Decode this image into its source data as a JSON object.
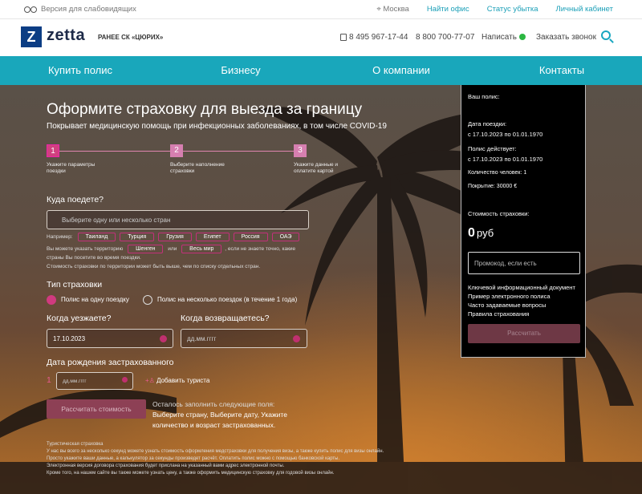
{
  "topbar": {
    "accessibility": "Версия для слабовидящих",
    "city": "Москва",
    "links": [
      "Найти офис",
      "Статус убытка",
      "Личный кабинет"
    ]
  },
  "header": {
    "logo_letter": "Z",
    "logo_text": "zetta",
    "former_name": "РАНЕЕ СК «ЦЮРИХ»",
    "phone1": "8 495 967-17-44",
    "phone2": "8 800 700-77-07",
    "write": "Написать",
    "callback": "Заказать звонок"
  },
  "nav": [
    "Купить полис",
    "Бизнесу",
    "О компании",
    "Контакты"
  ],
  "form": {
    "title": "Оформите страховку для выезда за границу",
    "subtitle": "Покрывает медицинскую помощь при инфекционных заболеваниях, в том числе COVID-19",
    "steps": [
      {
        "num": "1",
        "label": "Укажите параметры поездки"
      },
      {
        "num": "2",
        "label": "Выберите наполнение страховки"
      },
      {
        "num": "3",
        "label": "Укажите данные и оплатите картой"
      }
    ],
    "where_label": "Куда поедете?",
    "where_placeholder": "Выберите одну или несколько стран",
    "example_label": "Например:",
    "countries": [
      "Таиланд",
      "Турция",
      "Грузия",
      "Египет",
      "Россия",
      "ОАЭ"
    ],
    "territory_text_1": "Вы можете указать территорию",
    "territory_schengen": "Шенген",
    "territory_or": "или",
    "territory_world": "Весь мир",
    "territory_text_2": ", если не знаете точно, какие",
    "territory_text_3": "страны Вы посетите во время поездки.",
    "territory_text_4": "Стоимость страховки по территории может быть выше, чем по списку отдельных стран.",
    "type_label": "Тип страховки",
    "type_options": [
      "Полис на одну поездку",
      "Полис на несколько поездок (в течение 1 года)"
    ],
    "depart_label": "Когда уезжаете?",
    "depart_value": "17.10.2023",
    "return_label": "Когда возвращаетесь?",
    "return_placeholder": "дд.мм.гггг",
    "birth_label": "Дата рождения застрахованного",
    "birth_index": "1",
    "birth_placeholder": "дд.мм.гггг",
    "add_tourist": "Добавить туриста",
    "calc_button": "Рассчитать стоимость",
    "remain_title": "Осталось заполнить следующие поля:",
    "remain_text": "Выберите страну, Выберите дату, Укажите количество и возраст застрахованных.",
    "footer": [
      "Туристическая страховка",
      "У нас вы всего за несколько секунд можете узнать стоимость оформления медстраховки для получения визы, а также купить полис для визы онлайн.",
      "Просто укажите ваши данные, а калькулятор за секунды произведет расчёт. Оплатить полис можно с помощью банковской карты.",
      "Электронная версия договора страхования будет прислана на указанный вами адрес электронной почты.",
      "Кроме того, на нашем сайте вы также можете узнать цену, а также оформить медицинскую страховку для годовой визы онлайн."
    ]
  },
  "panel": {
    "title": "Ваш полис:",
    "trip_label": "Дата поездки:",
    "trip_value": "с 17.10.2023 по 01.01.1970",
    "valid_label": "Полис действует:",
    "valid_value": "с 17.10.2023 по 01.01.1970",
    "people": "Количество человек: 1",
    "coverage": "Покрытие: 30000 €",
    "cost_label": "Стоимость страховки:",
    "cost_value": "0",
    "cost_currency": "руб",
    "promo_placeholder": "Промокод, если есть",
    "links": [
      "Ключевой информационный документ",
      "Пример электронного полиса",
      "Часто задаваемые вопросы",
      "Правила страхования"
    ],
    "button": "Рассчитать"
  },
  "colors": {
    "accent": "#19a7bb",
    "brand": "#0b3d84",
    "pink": "#d03a7f"
  }
}
